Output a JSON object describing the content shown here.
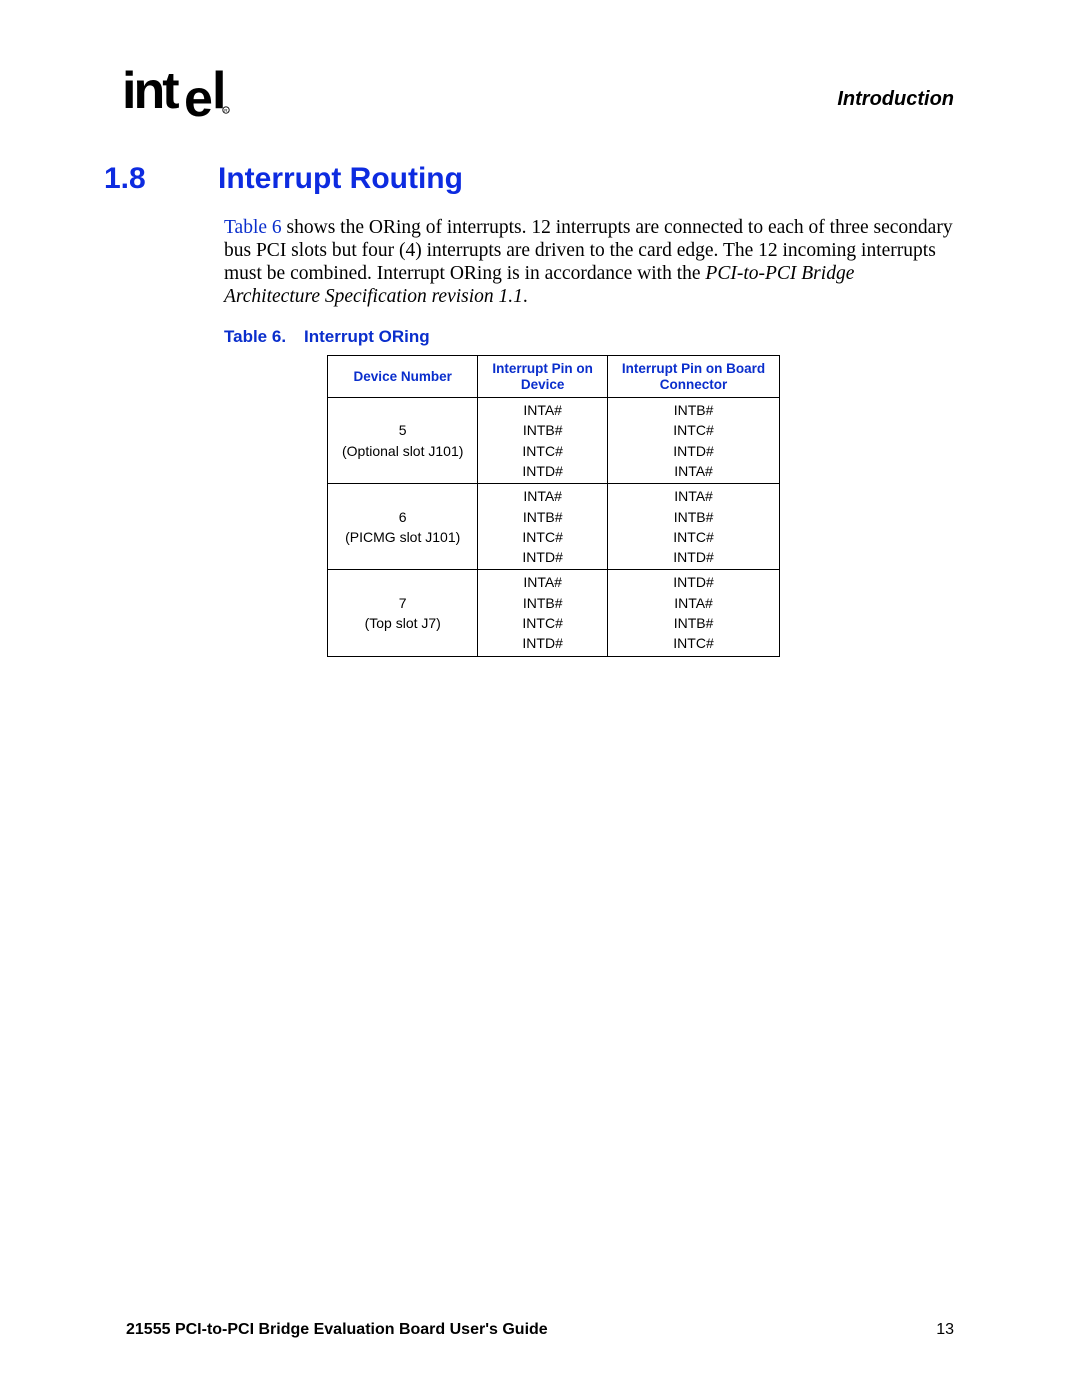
{
  "header": {
    "brand": "intel",
    "section_label": "Introduction"
  },
  "section": {
    "number": "1.8",
    "title": "Interrupt Routing"
  },
  "paragraph": {
    "ref": "Table 6",
    "text_after_ref": " shows the ORing of interrupts. 12 interrupts are connected to each of three secondary bus PCI slots but four (4) interrupts are driven to the card edge. The 12 incoming interrupts must be combined. Interrupt ORing is in accordance with the ",
    "italic": "PCI-to-PCI Bridge Architecture Specification revision 1.1",
    "tail": "."
  },
  "table": {
    "caption_label": "Table 6.",
    "caption_title": "Interrupt ORing",
    "headers": {
      "c1": "Device Number",
      "c2a": "Interrupt Pin on",
      "c2b": "Device",
      "c3a": "Interrupt Pin on Board",
      "c3b": "Connector"
    },
    "rows": [
      {
        "device_num": "5",
        "device_note": "(Optional slot J101)",
        "pins_dev": [
          "INTA#",
          "INTB#",
          "INTC#",
          "INTD#"
        ],
        "pins_board": [
          "INTB#",
          "INTC#",
          "INTD#",
          "INTA#"
        ]
      },
      {
        "device_num": "6",
        "device_note": "(PICMG slot J101)",
        "pins_dev": [
          "INTA#",
          "INTB#",
          "INTC#",
          "INTD#"
        ],
        "pins_board": [
          "INTA#",
          "INTB#",
          "INTC#",
          "INTD#"
        ]
      },
      {
        "device_num": "7",
        "device_note": "(Top slot J7)",
        "pins_dev": [
          "INTA#",
          "INTB#",
          "INTC#",
          "INTD#"
        ],
        "pins_board": [
          "INTD#",
          "INTA#",
          "INTB#",
          "INTC#"
        ]
      }
    ]
  },
  "footer": {
    "doc_title": "21555 PCI-to-PCI Bridge Evaluation Board User's Guide",
    "page_number": "13"
  }
}
